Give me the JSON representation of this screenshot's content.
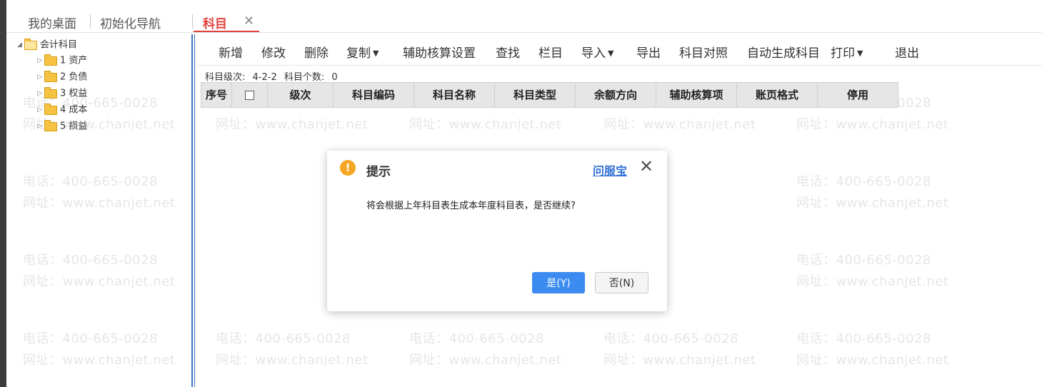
{
  "tabs": {
    "desktop": "我的桌面",
    "init_nav": "初始化导航",
    "active": "科目",
    "close_glyph": "✕"
  },
  "tree": {
    "root": "会计科目",
    "items": [
      "1 资产",
      "2 负债",
      "3 权益",
      "4 成本",
      "5 损益"
    ]
  },
  "toolbar": {
    "add": "新增",
    "edit": "修改",
    "delete": "删除",
    "copy": "复制",
    "aux_setting": "辅助核算设置",
    "find": "查找",
    "columns": "栏目",
    "import": "导入",
    "export": "导出",
    "compare": "科目对照",
    "auto_gen": "自动生成科目",
    "print": "打印",
    "exit": "退出"
  },
  "info": {
    "level_label": "科目级次:",
    "level_value": "4-2-2",
    "count_label": "科目个数:",
    "count_value": "0"
  },
  "table": {
    "columns": [
      "序号",
      "",
      "级次",
      "科目编码",
      "科目名称",
      "科目类型",
      "余额方向",
      "辅助核算项",
      "账页格式",
      "停用"
    ]
  },
  "dialog": {
    "title": "提示",
    "help_link": "问服宝",
    "message": "将会根据上年科目表生成本年度科目表，是否继续?",
    "yes": "是(Y)",
    "no": "否(N)"
  },
  "watermark": {
    "phone": "电话：400-665-0028",
    "site": "网址：www.chanjet.net"
  },
  "colors": {
    "accent_red": "#e0413a",
    "primary_blue": "#3b8bf0",
    "link_blue": "#2f6fd6",
    "warning_orange": "#f5a623"
  }
}
